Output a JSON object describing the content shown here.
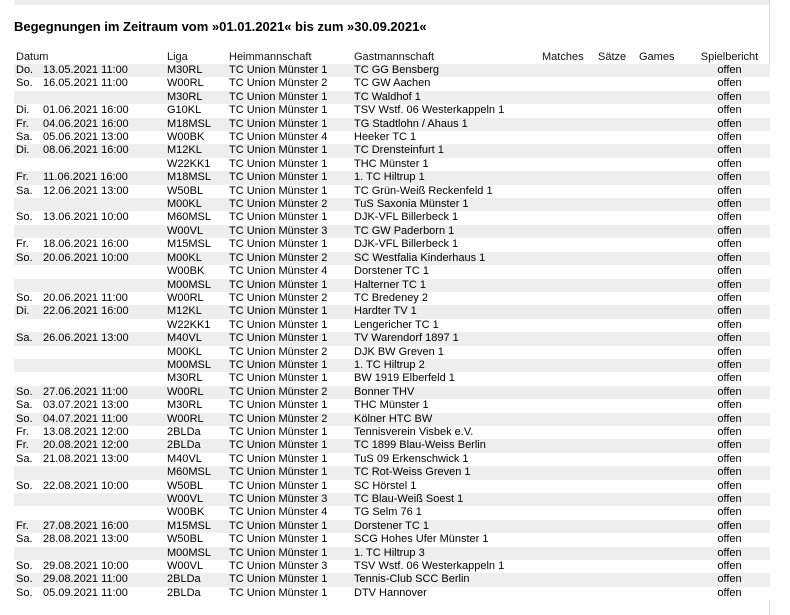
{
  "title": "Begegnungen im Zeitraum vom »01.01.2021« bis zum »30.09.2021«",
  "columns": {
    "datum": "Datum",
    "liga": "Liga",
    "heim": "Heimmannschaft",
    "gast": "Gastmannschaft",
    "matches": "Matches",
    "saetze": "Sätze",
    "games": "Games",
    "bericht": "Spielbericht"
  },
  "rows": [
    {
      "day": "Do.",
      "time": "13.05.2021 11:00",
      "liga": "M30RL",
      "home": "TC Union Münster 1",
      "guest": "TC GG Bensberg",
      "report": "offen"
    },
    {
      "day": "So.",
      "time": "16.05.2021 11:00",
      "liga": "W00RL",
      "home": "TC Union Münster 2",
      "guest": "TC GW Aachen",
      "report": "offen"
    },
    {
      "day": "",
      "time": "",
      "liga": "M30RL",
      "home": "TC Union Münster 1",
      "guest": "TC Waldhof 1",
      "report": "offen"
    },
    {
      "day": "Di.",
      "time": "01.06.2021 16:00",
      "liga": "G10KL",
      "home": "TC Union Münster 1",
      "guest": "TSV Wstf. 06 Westerkappeln 1",
      "report": "offen"
    },
    {
      "day": "Fr.",
      "time": "04.06.2021 16:00",
      "liga": "M18MSL",
      "home": "TC Union Münster 1",
      "guest": "TG Stadtlohn / Ahaus 1",
      "report": "offen"
    },
    {
      "day": "Sa.",
      "time": "05.06.2021 13:00",
      "liga": "W00BK",
      "home": "TC Union Münster 4",
      "guest": "Heeker TC 1",
      "report": "offen"
    },
    {
      "day": "Di.",
      "time": "08.06.2021 16:00",
      "liga": "M12KL",
      "home": "TC Union Münster 1",
      "guest": "TC Drensteinfurt 1",
      "report": "offen"
    },
    {
      "day": "",
      "time": "",
      "liga": "W22KK1",
      "home": "TC Union Münster 1",
      "guest": "THC Münster 1",
      "report": "offen"
    },
    {
      "day": "Fr.",
      "time": "11.06.2021 16:00",
      "liga": "M18MSL",
      "home": "TC Union Münster 1",
      "guest": "1. TC Hiltrup 1",
      "report": "offen"
    },
    {
      "day": "Sa.",
      "time": "12.06.2021 13:00",
      "liga": "W50BL",
      "home": "TC Union Münster 1",
      "guest": "TC Grün-Weiß Reckenfeld 1",
      "report": "offen"
    },
    {
      "day": "",
      "time": "",
      "liga": "M00KL",
      "home": "TC Union Münster 2",
      "guest": "TuS Saxonia Münster 1",
      "report": "offen"
    },
    {
      "day": "So.",
      "time": "13.06.2021 10:00",
      "liga": "M60MSL",
      "home": "TC Union Münster 1",
      "guest": "DJK-VFL Billerbeck 1",
      "report": "offen"
    },
    {
      "day": "",
      "time": "",
      "liga": "W00VL",
      "home": "TC Union Münster 3",
      "guest": "TC GW Paderborn 1",
      "report": "offen"
    },
    {
      "day": "Fr.",
      "time": "18.06.2021 16:00",
      "liga": "M15MSL",
      "home": "TC Union Münster 1",
      "guest": "DJK-VFL Billerbeck 1",
      "report": "offen"
    },
    {
      "day": "So.",
      "time": "20.06.2021 10:00",
      "liga": "M00KL",
      "home": "TC Union Münster 2",
      "guest": "SC Westfalia Kinderhaus 1",
      "report": "offen"
    },
    {
      "day": "",
      "time": "",
      "liga": "W00BK",
      "home": "TC Union Münster 4",
      "guest": "Dorstener TC 1",
      "report": "offen"
    },
    {
      "day": "",
      "time": "",
      "liga": "M00MSL",
      "home": "TC Union Münster 1",
      "guest": "Halterner TC 1",
      "report": "offen"
    },
    {
      "day": "So.",
      "time": "20.06.2021 11:00",
      "liga": "W00RL",
      "home": "TC Union Münster 2",
      "guest": "TC Bredeney 2",
      "report": "offen"
    },
    {
      "day": "Di.",
      "time": "22.06.2021 16:00",
      "liga": "M12KL",
      "home": "TC Union Münster 1",
      "guest": "Hardter TV 1",
      "report": "offen"
    },
    {
      "day": "",
      "time": "",
      "liga": "W22KK1",
      "home": "TC Union Münster 1",
      "guest": "Lengericher TC 1",
      "report": "offen"
    },
    {
      "day": "Sa.",
      "time": "26.06.2021 13:00",
      "liga": "M40VL",
      "home": "TC Union Münster 1",
      "guest": "TV Warendorf 1897 1",
      "report": "offen"
    },
    {
      "day": "",
      "time": "",
      "liga": "M00KL",
      "home": "TC Union Münster 2",
      "guest": "DJK BW Greven 1",
      "report": "offen"
    },
    {
      "day": "",
      "time": "",
      "liga": "M00MSL",
      "home": "TC Union Münster 1",
      "guest": "1. TC Hiltrup 2",
      "report": "offen"
    },
    {
      "day": "",
      "time": "",
      "liga": "M30RL",
      "home": "TC Union Münster 1",
      "guest": "BW 1919 Elberfeld 1",
      "report": "offen"
    },
    {
      "day": "So.",
      "time": "27.06.2021 11:00",
      "liga": "W00RL",
      "home": "TC Union Münster 2",
      "guest": "Bonner THV",
      "report": "offen"
    },
    {
      "day": "Sa.",
      "time": "03.07.2021 13:00",
      "liga": "M30RL",
      "home": "TC Union Münster 1",
      "guest": "THC Münster 1",
      "report": "offen"
    },
    {
      "day": "So.",
      "time": "04.07.2021 11:00",
      "liga": "W00RL",
      "home": "TC Union Münster 2",
      "guest": "Kölner HTC BW",
      "report": "offen"
    },
    {
      "day": "Fr.",
      "time": "13.08.2021 12:00",
      "liga": "2BLDa",
      "home": "TC Union Münster 1",
      "guest": "Tennisverein Visbek e.V.",
      "report": "offen"
    },
    {
      "day": "Fr.",
      "time": "20.08.2021 12:00",
      "liga": "2BLDa",
      "home": "TC Union Münster 1",
      "guest": "TC 1899 Blau-Weiss Berlin",
      "report": "offen"
    },
    {
      "day": "Sa.",
      "time": "21.08.2021 13:00",
      "liga": "M40VL",
      "home": "TC Union Münster 1",
      "guest": "TuS 09 Erkenschwick 1",
      "report": "offen"
    },
    {
      "day": "",
      "time": "",
      "liga": "M60MSL",
      "home": "TC Union Münster 1",
      "guest": "TC Rot-Weiss Greven 1",
      "report": "offen"
    },
    {
      "day": "So.",
      "time": "22.08.2021 10:00",
      "liga": "W50BL",
      "home": "TC Union Münster 1",
      "guest": "SC Hörstel 1",
      "report": "offen"
    },
    {
      "day": "",
      "time": "",
      "liga": "W00VL",
      "home": "TC Union Münster 3",
      "guest": "TC Blau-Weiß Soest 1",
      "report": "offen"
    },
    {
      "day": "",
      "time": "",
      "liga": "W00BK",
      "home": "TC Union Münster 4",
      "guest": "TG Selm 76 1",
      "report": "offen"
    },
    {
      "day": "Fr.",
      "time": "27.08.2021 16:00",
      "liga": "M15MSL",
      "home": "TC Union Münster 1",
      "guest": "Dorstener TC 1",
      "report": "offen"
    },
    {
      "day": "Sa.",
      "time": "28.08.2021 13:00",
      "liga": "W50BL",
      "home": "TC Union Münster 1",
      "guest": "SCG Hohes Ufer Münster 1",
      "report": "offen"
    },
    {
      "day": "",
      "time": "",
      "liga": "M00MSL",
      "home": "TC Union Münster 1",
      "guest": "1. TC Hiltrup 3",
      "report": "offen"
    },
    {
      "day": "So.",
      "time": "29.08.2021 10:00",
      "liga": "W00VL",
      "home": "TC Union Münster 3",
      "guest": "TSV Wstf. 06 Westerkappeln 1",
      "report": "offen"
    },
    {
      "day": "So.",
      "time": "29.08.2021 11:00",
      "liga": "2BLDa",
      "home": "TC Union Münster 1",
      "guest": "Tennis-Club SCC Berlin",
      "report": "offen"
    },
    {
      "day": "So.",
      "time": "05.09.2021 11:00",
      "liga": "2BLDa",
      "home": "TC Union Münster 1",
      "guest": "DTV Hannover",
      "report": "offen"
    }
  ]
}
